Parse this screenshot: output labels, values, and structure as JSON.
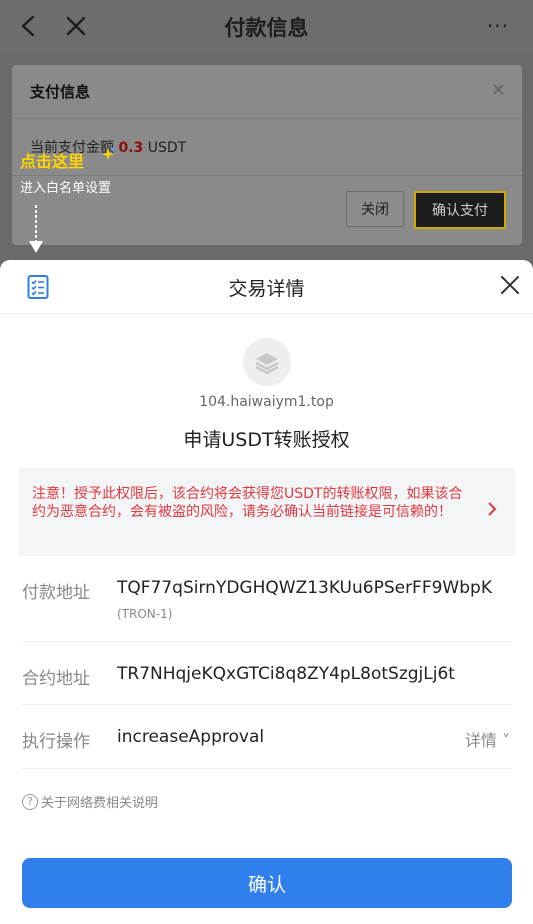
{
  "topbar": {
    "title": "付款信息",
    "more": "···"
  },
  "pay_dialog": {
    "title": "支付信息",
    "close_x": "×",
    "amount_label": "当前支付金额",
    "amount_value": "0.3",
    "amount_unit": "USDT",
    "close_button": "关闭",
    "confirm_button": "确认支付"
  },
  "annotation": {
    "title": "点击这里",
    "subtitle": "进入白名单设置"
  },
  "sheet": {
    "title": "交易详情",
    "domain": "104.haiwaiym1.top",
    "request": "申请USDT转账授权",
    "warning": "注意！授予此权限后，该合约将会获得您USDT的转账权限，如果该合约为恶意合约，会有被盗的风险，请务必确认当前链接是可信赖的！",
    "rows": [
      {
        "label": "付款地址",
        "value": "TQF77qSirnYDGHQWZ13KUu6PSerFF9WbpK",
        "sub": "(TRON-1)"
      },
      {
        "label": "合约地址",
        "value": "TR7NHqjeKQxGTCi8q8ZY4pL8otSzgjLj6t"
      },
      {
        "label": "执行操作",
        "value": "increaseApproval",
        "more": "详情 ˅"
      }
    ],
    "fee_hint": "关于网络费相关说明",
    "confirm": "确认"
  },
  "colors": {
    "accent": "#2f80ed",
    "warning": "#e0393e",
    "annotation": "#ffd400"
  }
}
